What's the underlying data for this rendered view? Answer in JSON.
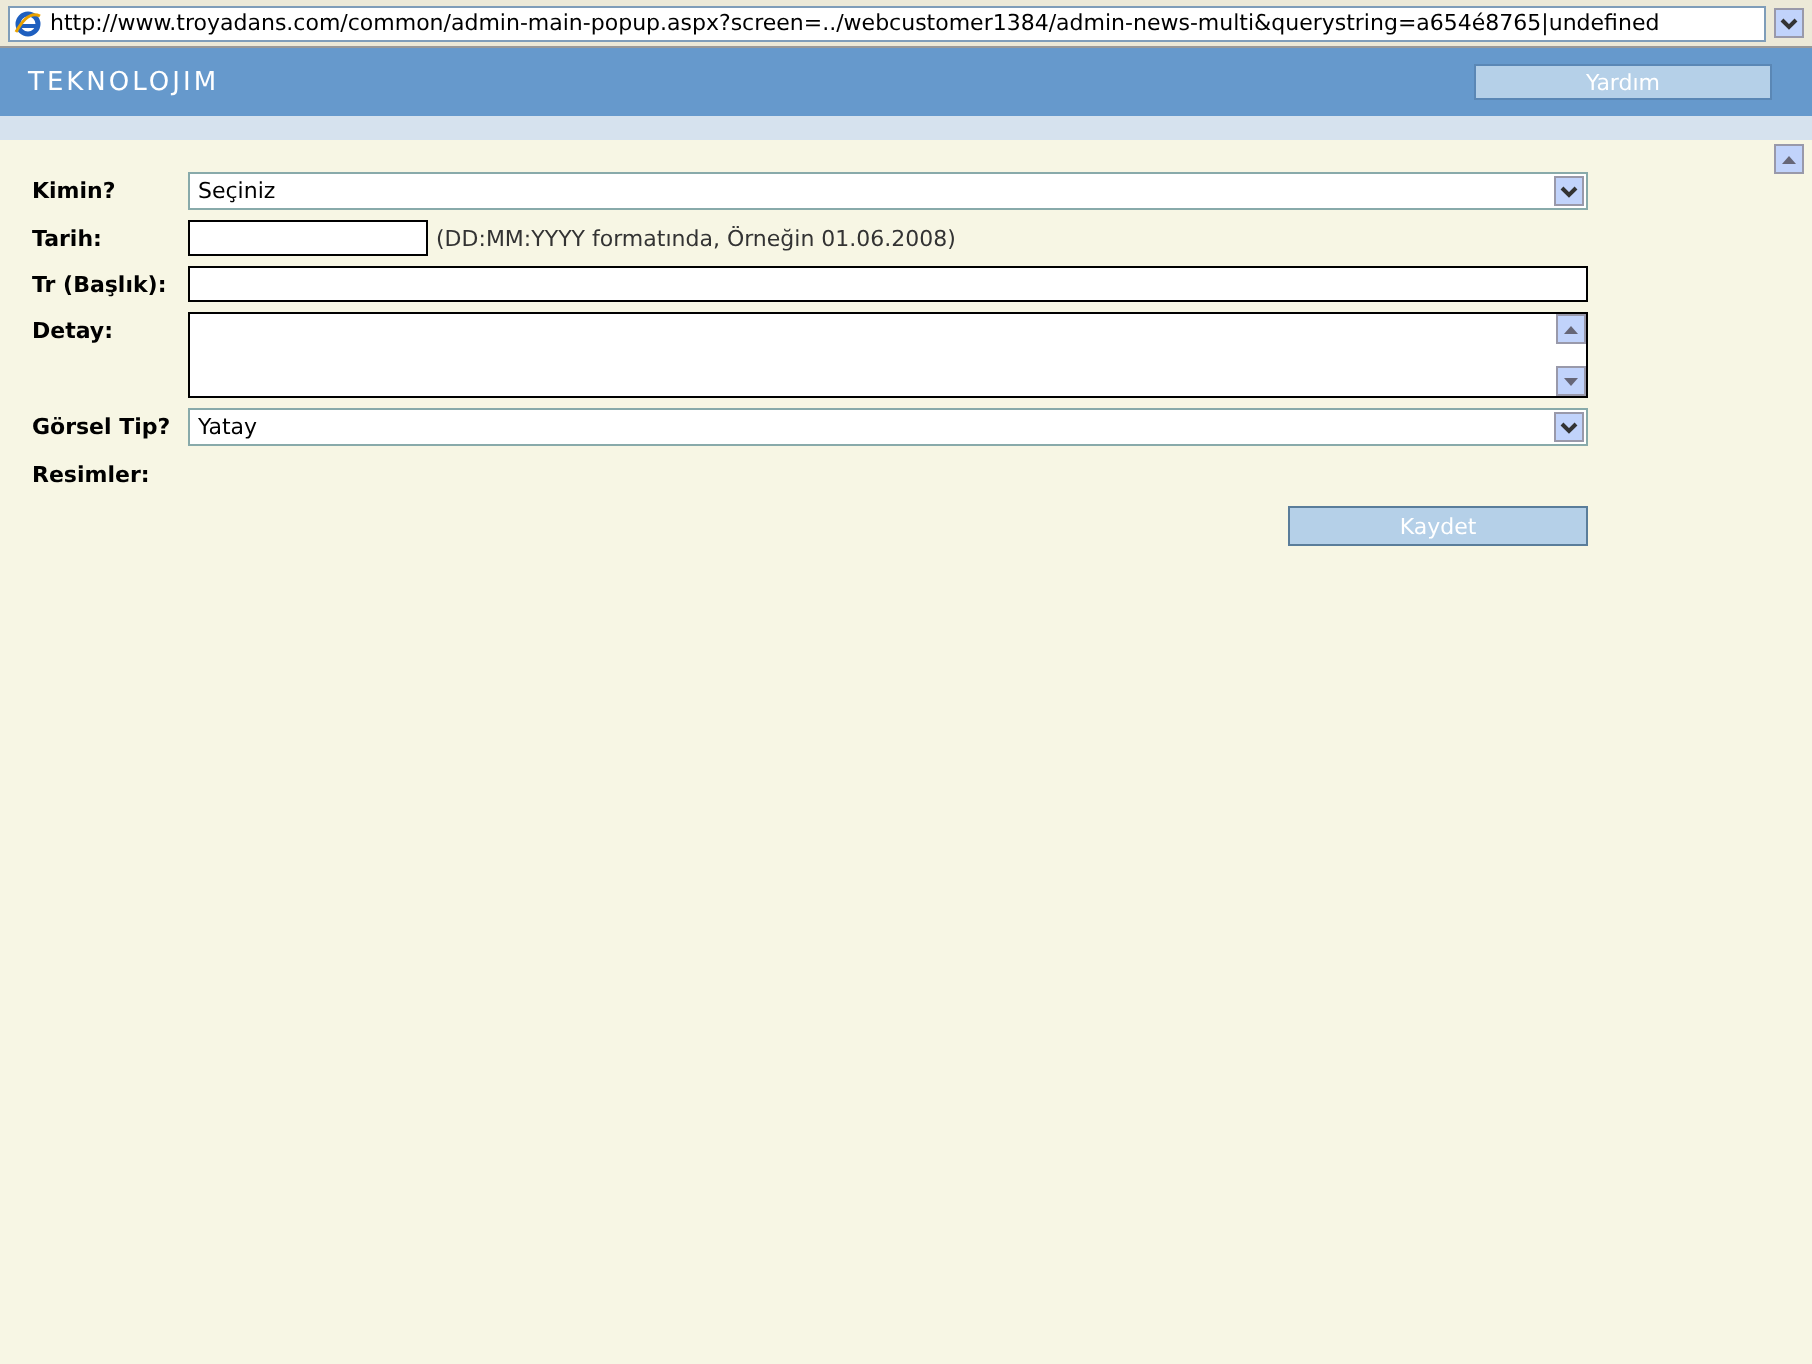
{
  "address_bar": {
    "url": "http://www.troyadans.com/common/admin-main-popup.aspx?screen=../webcustomer1384/admin-news-multi&querystring=a654é8765|undefined"
  },
  "header": {
    "logo": "TEKNOLOJIM",
    "help_button": "Yardım"
  },
  "form": {
    "fields": [
      {
        "kind": "select",
        "label": "Kimin?",
        "value": "Seçiniz"
      },
      {
        "kind": "date",
        "label": "Tarih:",
        "hint": "(DD:MM:YYYY formatında, Örneğin 01.06.2008)"
      },
      {
        "kind": "text",
        "label": "Tr (Başlık):"
      },
      {
        "kind": "textarea",
        "label": "Detay:"
      },
      {
        "kind": "select",
        "label": "Görsel Tip?",
        "value": "Yatay"
      },
      {
        "kind": "label",
        "label": "Resimler:"
      }
    ],
    "save_button": "Kaydet"
  }
}
